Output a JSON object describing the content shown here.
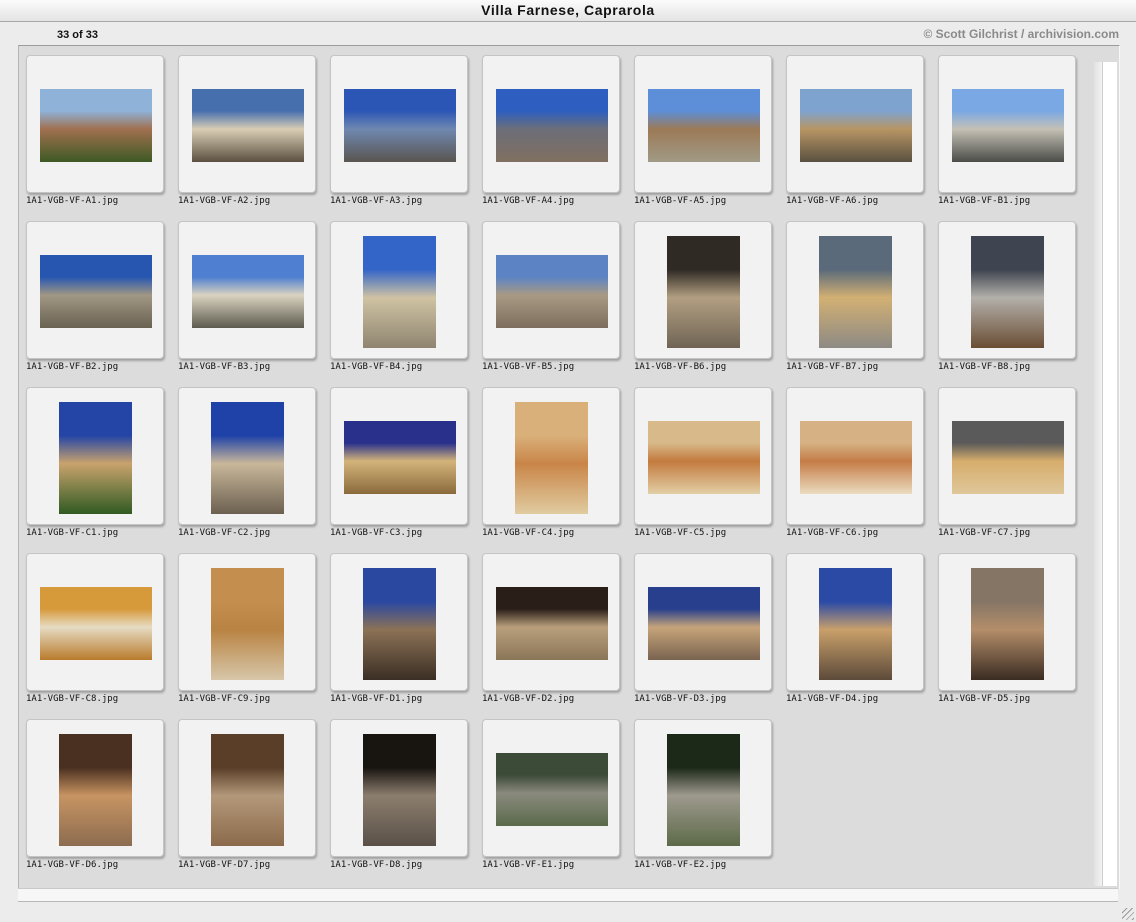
{
  "window": {
    "title": "Villa Farnese, Caprarola"
  },
  "header": {
    "count": "33 of 33",
    "credit": "© Scott Gilchrist / archivision.com"
  },
  "thumbnails": [
    {
      "label": "1A1-VGB-VF-A1.jpg",
      "orientation": "landscape",
      "palette": [
        "#8fb2d8",
        "#a07050",
        "#3d5a24"
      ]
    },
    {
      "label": "1A1-VGB-VF-A2.jpg",
      "orientation": "landscape",
      "palette": [
        "#466fae",
        "#d8cdb4",
        "#5b5040"
      ]
    },
    {
      "label": "1A1-VGB-VF-A3.jpg",
      "orientation": "landscape",
      "palette": [
        "#2c56b5",
        "#6f88b0",
        "#5a5550"
      ]
    },
    {
      "label": "1A1-VGB-VF-A4.jpg",
      "orientation": "landscape",
      "palette": [
        "#2e5fc0",
        "#6c6e78",
        "#807060"
      ]
    },
    {
      "label": "1A1-VGB-VF-A5.jpg",
      "orientation": "landscape",
      "palette": [
        "#5d8fd8",
        "#9c7a56",
        "#a09a86"
      ]
    },
    {
      "label": "1A1-VGB-VF-A6.jpg",
      "orientation": "landscape",
      "palette": [
        "#7fa3cf",
        "#b79564",
        "#5a5040"
      ]
    },
    {
      "label": "1A1-VGB-VF-B1.jpg",
      "orientation": "landscape",
      "palette": [
        "#7aa8e4",
        "#c4c0b4",
        "#4a4c48"
      ]
    },
    {
      "label": "1A1-VGB-VF-B2.jpg",
      "orientation": "landscape",
      "palette": [
        "#2756b0",
        "#a09784",
        "#6a6252"
      ]
    },
    {
      "label": "1A1-VGB-VF-B3.jpg",
      "orientation": "landscape",
      "palette": [
        "#4e7fd0",
        "#dad3c1",
        "#5c5a4e"
      ]
    },
    {
      "label": "1A1-VGB-VF-B4.jpg",
      "orientation": "portrait",
      "palette": [
        "#3365c8",
        "#cfc3a3",
        "#8f8570"
      ]
    },
    {
      "label": "1A1-VGB-VF-B5.jpg",
      "orientation": "landscape",
      "palette": [
        "#5c84c4",
        "#a89a84",
        "#7c6e5c"
      ]
    },
    {
      "label": "1A1-VGB-VF-B6.jpg",
      "orientation": "portrait",
      "palette": [
        "#2f2a24",
        "#b29f82",
        "#6f6454"
      ]
    },
    {
      "label": "1A1-VGB-VF-B7.jpg",
      "orientation": "portrait",
      "palette": [
        "#5a6a7a",
        "#d2b073",
        "#8d8a84"
      ]
    },
    {
      "label": "1A1-VGB-VF-B8.jpg",
      "orientation": "portrait",
      "palette": [
        "#3e4450",
        "#b3b0aa",
        "#6a4e34"
      ]
    },
    {
      "label": "1A1-VGB-VF-C1.jpg",
      "orientation": "portrait",
      "palette": [
        "#2445a6",
        "#c9a36c",
        "#2f5a22"
      ]
    },
    {
      "label": "1A1-VGB-VF-C2.jpg",
      "orientation": "portrait",
      "palette": [
        "#1f42a8",
        "#c9b79a",
        "#6b6050"
      ]
    },
    {
      "label": "1A1-VGB-VF-C3.jpg",
      "orientation": "landscape",
      "palette": [
        "#28308c",
        "#d3b47a",
        "#8a6a3c"
      ]
    },
    {
      "label": "1A1-VGB-VF-C4.jpg",
      "orientation": "portrait",
      "palette": [
        "#d9b07a",
        "#c98548",
        "#e0cca0"
      ]
    },
    {
      "label": "1A1-VGB-VF-C5.jpg",
      "orientation": "landscape",
      "palette": [
        "#d7b98a",
        "#c37a3e",
        "#e2cfa6"
      ]
    },
    {
      "label": "1A1-VGB-VF-C6.jpg",
      "orientation": "landscape",
      "palette": [
        "#d6b183",
        "#c47c47",
        "#ebdcc0"
      ]
    },
    {
      "label": "1A1-VGB-VF-C7.jpg",
      "orientation": "landscape",
      "palette": [
        "#5a5a5a",
        "#d6ad6c",
        "#dfc79a"
      ]
    },
    {
      "label": "1A1-VGB-VF-C8.jpg",
      "orientation": "landscape",
      "palette": [
        "#d79a3b",
        "#e6dcc4",
        "#b97a2c"
      ]
    },
    {
      "label": "1A1-VGB-VF-C9.jpg",
      "orientation": "portrait",
      "palette": [
        "#c48e4e",
        "#b98343",
        "#d7c7a9"
      ]
    },
    {
      "label": "1A1-VGB-VF-D1.jpg",
      "orientation": "portrait",
      "palette": [
        "#2a48a0",
        "#8c7256",
        "#3a2e24"
      ]
    },
    {
      "label": "1A1-VGB-VF-D2.jpg",
      "orientation": "landscape",
      "palette": [
        "#2a1e18",
        "#b99f7c",
        "#8a7658"
      ]
    },
    {
      "label": "1A1-VGB-VF-D3.jpg",
      "orientation": "landscape",
      "palette": [
        "#273f8c",
        "#c6a47a",
        "#7a6450"
      ]
    },
    {
      "label": "1A1-VGB-VF-D4.jpg",
      "orientation": "portrait",
      "palette": [
        "#2a4aa6",
        "#c9a06a",
        "#5c4a3a"
      ]
    },
    {
      "label": "1A1-VGB-VF-D5.jpg",
      "orientation": "portrait",
      "palette": [
        "#857565",
        "#b48e6a",
        "#3a2c22"
      ]
    },
    {
      "label": "1A1-VGB-VF-D6.jpg",
      "orientation": "portrait",
      "palette": [
        "#4a3020",
        "#c79462",
        "#8c6c50"
      ]
    },
    {
      "label": "1A1-VGB-VF-D7.jpg",
      "orientation": "portrait",
      "palette": [
        "#5a3e28",
        "#b4987a",
        "#8a6a4a"
      ]
    },
    {
      "label": "1A1-VGB-VF-D8.jpg",
      "orientation": "portrait",
      "palette": [
        "#181410",
        "#8c7e6e",
        "#5a5048"
      ]
    },
    {
      "label": "1A1-VGB-VF-E1.jpg",
      "orientation": "landscape",
      "palette": [
        "#3c4a38",
        "#8a8a7e",
        "#5a6a4a"
      ]
    },
    {
      "label": "1A1-VGB-VF-E2.jpg",
      "orientation": "portrait",
      "palette": [
        "#1c2818",
        "#9e9a8e",
        "#5c6a48"
      ]
    }
  ]
}
